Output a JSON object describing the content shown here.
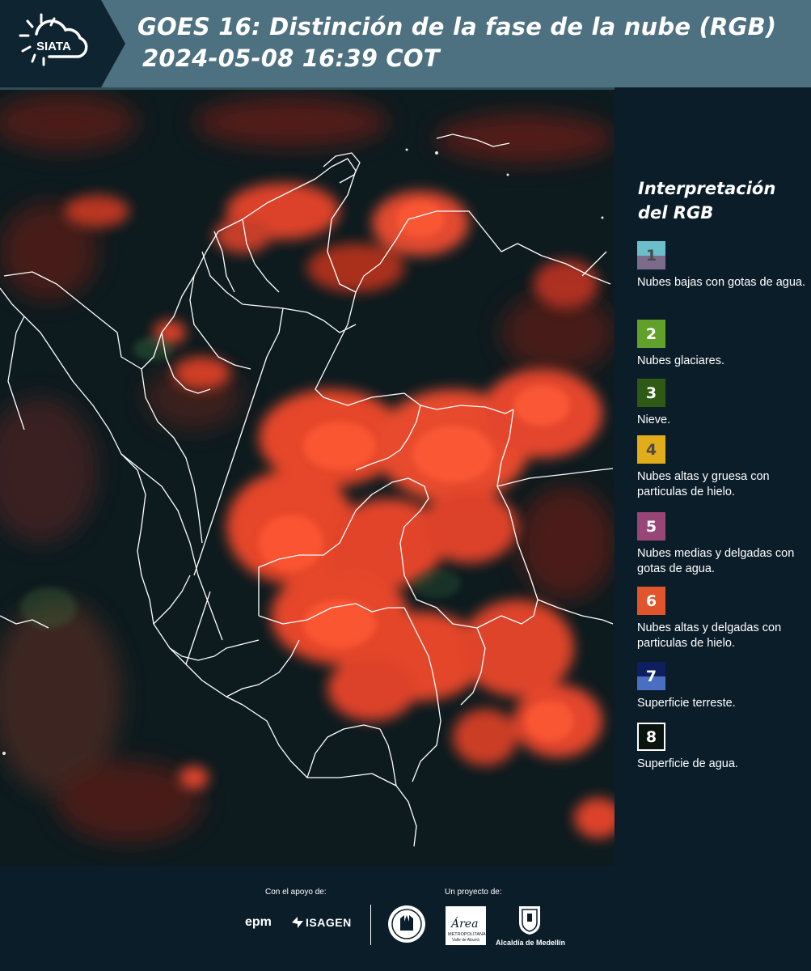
{
  "header": {
    "logo_text": "SIATA",
    "title_line1": "GOES 16: Distinción de la fase de la nube (RGB)",
    "title_line2": "2024-05-08 16:39 COT"
  },
  "legend": {
    "title_line1": "Interpretación",
    "title_line2": "del RGB",
    "items": [
      {
        "number": "1",
        "label": "Nubes bajas con gotas de agua.",
        "color_top": "#6bbfca",
        "color_bottom": "#7c6b8a",
        "number_color": "#4a4a4a"
      },
      {
        "number": "2",
        "label": "Nubes glaciares.",
        "color_top": "#61a02a",
        "color_bottom": "#61a02a",
        "number_color": "#ffffff"
      },
      {
        "number": "3",
        "label": "Nieve.",
        "color_top": "#2e5a16",
        "color_bottom": "#2e5a16",
        "number_color": "#ffffff"
      },
      {
        "number": "4",
        "label": "Nubes altas y gruesa con particulas de hielo.",
        "color_top": "#e1ad1a",
        "color_bottom": "#e1ad1a",
        "number_color": "#4a4a4a"
      },
      {
        "number": "5",
        "label": "Nubes medias y delgadas con gotas de agua.",
        "color_top": "#9a4578",
        "color_bottom": "#9a4578",
        "number_color": "#ffffff"
      },
      {
        "number": "6",
        "label": "Nubes altas y delgadas con particulas de hielo.",
        "color_top": "#e2542c",
        "color_bottom": "#e2542c",
        "number_color": "#ffffff"
      },
      {
        "number": "7",
        "label": "Superficie terreste.",
        "color_top": "#0e1e5e",
        "color_bottom": "#4a6fc2",
        "number_color": "#ffffff"
      },
      {
        "number": "8",
        "label": "Superficie de agua.",
        "color_top": "#0a140e",
        "color_bottom": "#0a140e",
        "number_color": "#ffffff",
        "border": "#ffffff"
      }
    ]
  },
  "footer": {
    "support_label": "Con el apoyo de:",
    "project_label": "Un proyecto de:",
    "epm": "epm",
    "isagen": "ISAGEN",
    "area_main": "Área",
    "area_sub1": "METROPOLITANA",
    "area_sub2": "Valle de Aburrá",
    "medellin": "Alcaldía de Medellín"
  },
  "colors": {
    "header_bg": "#4d7180",
    "page_bg": "#0c1d2a",
    "cloud_ice": "#f24a2c",
    "ground": "#0e1a1e"
  }
}
